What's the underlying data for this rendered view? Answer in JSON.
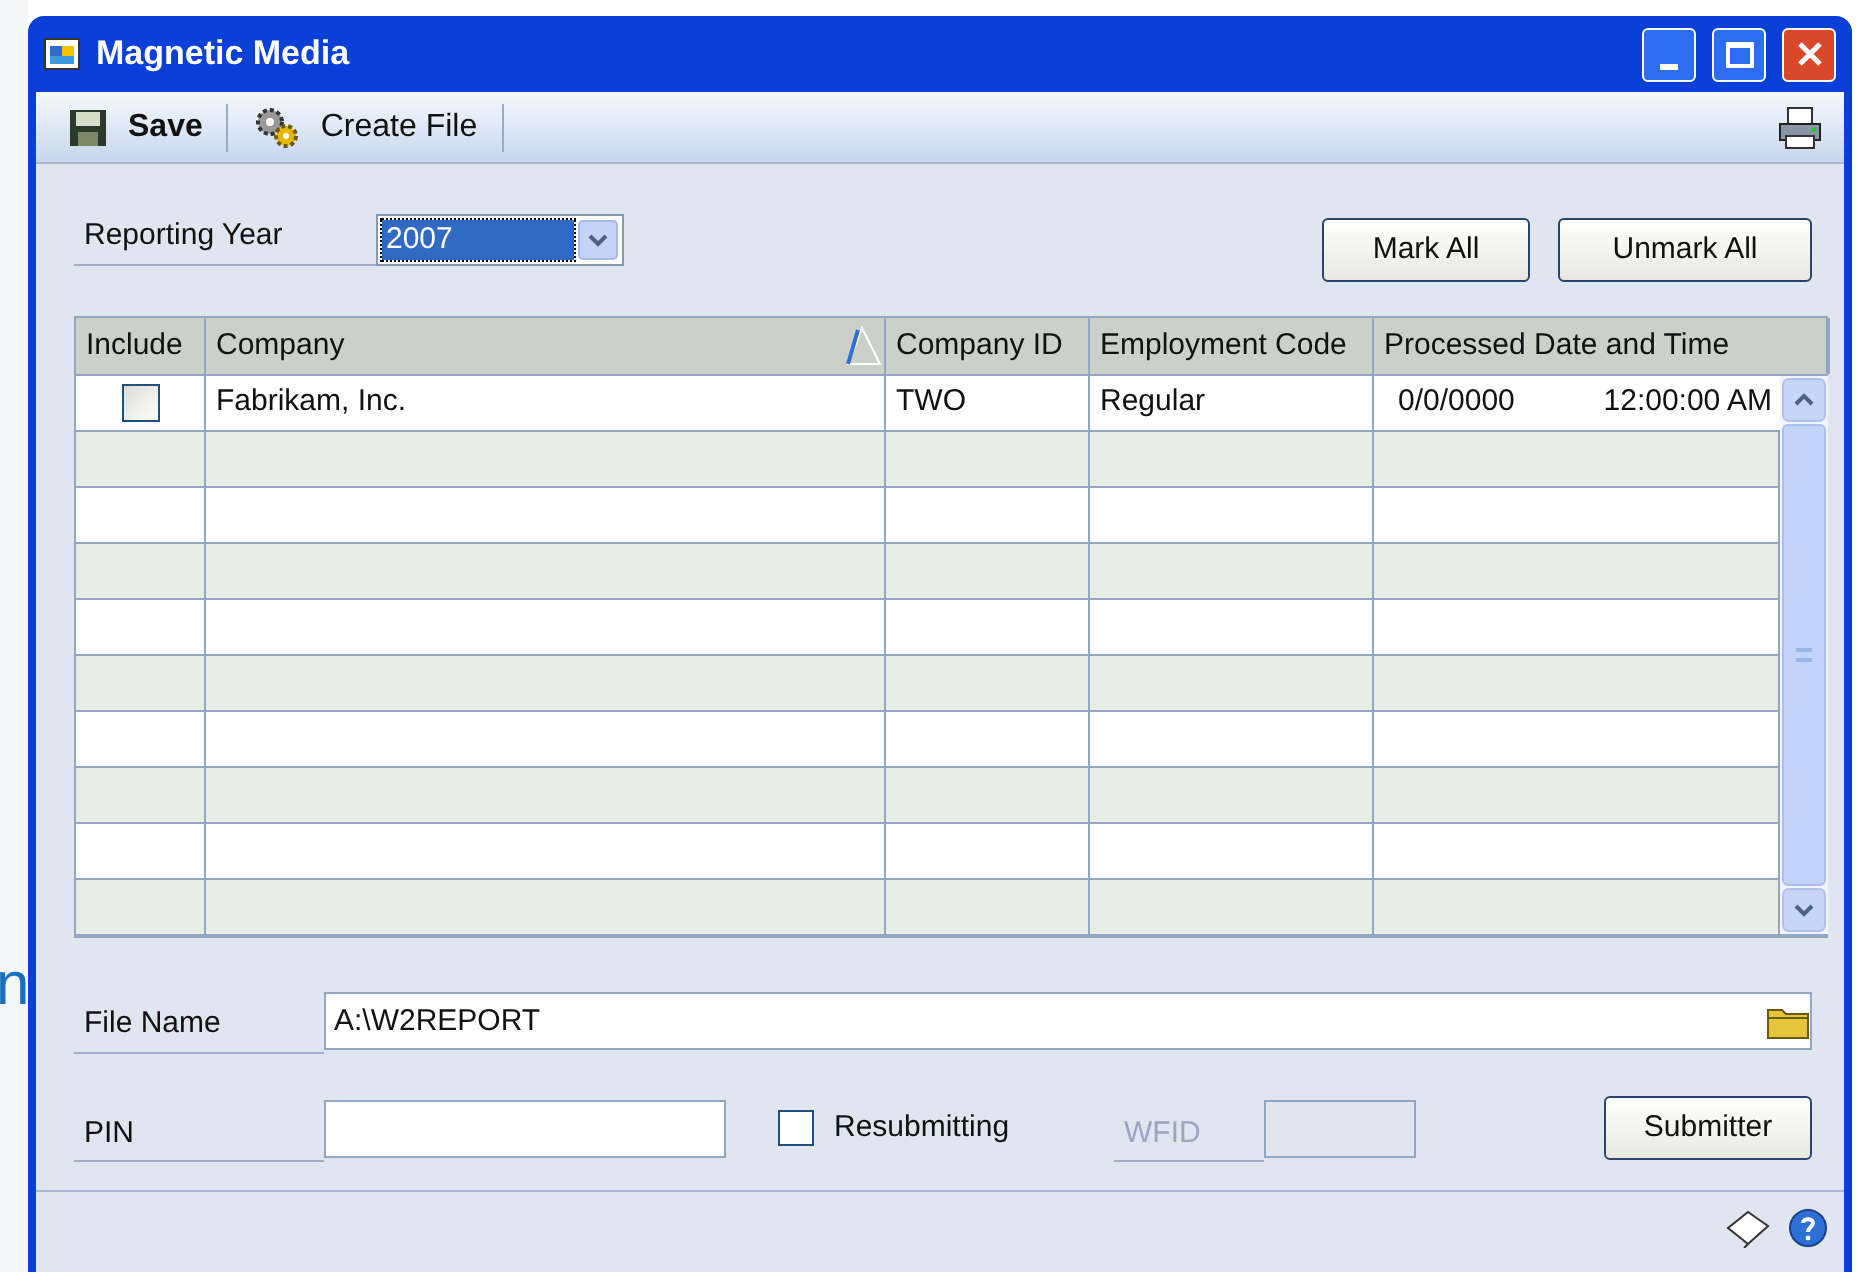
{
  "background_text": "n",
  "window": {
    "title": "Magnetic Media"
  },
  "toolbar": {
    "items": [
      {
        "kind": "save",
        "label": "Save"
      },
      {
        "kind": "create",
        "label": "Create File"
      }
    ]
  },
  "reporting_year": {
    "label": "Reporting Year",
    "value": "2007"
  },
  "buttons_top": [
    "Mark All",
    "Unmark All"
  ],
  "table": {
    "columns": [
      "Include",
      "Company",
      "Company ID",
      "Employment Code",
      "Processed Date and Time"
    ],
    "rows": [
      {
        "include": false,
        "company": "Fabrikam, Inc.",
        "company_id": "TWO",
        "employment_code": "Regular",
        "processed_date": "0/0/0000",
        "processed_time": "12:00:00 AM"
      }
    ]
  },
  "file_name": {
    "label": "File Name",
    "value": "A:\\W2REPORT"
  },
  "pin": {
    "label": "PIN"
  },
  "resubmitting": {
    "label": "Resubmitting",
    "checked": false
  },
  "wfid": {
    "label": "WFID",
    "disabled": true
  },
  "submitter_button": "Submitter"
}
